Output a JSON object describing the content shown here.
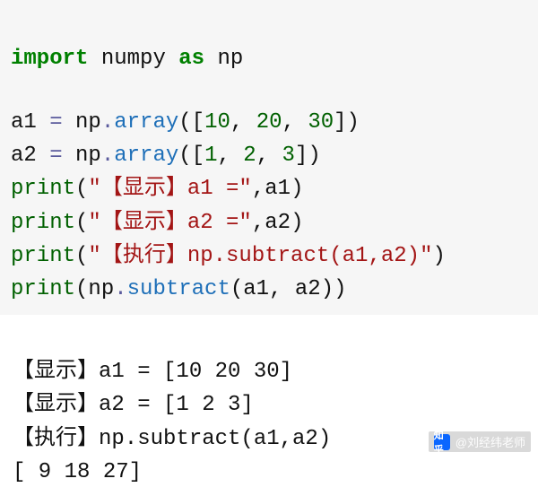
{
  "code": {
    "line1": {
      "import": "import",
      "numpy": "numpy",
      "as": "as",
      "np": "np"
    },
    "line3": {
      "a1": "a1",
      "eq": "=",
      "np": "np",
      "dot": ".",
      "array": "array",
      "lp": "(",
      "lb": "[",
      "v1": "10",
      "c": ",",
      "sp": " ",
      "v2": "20",
      "v3": "30",
      "rb": "]",
      "rp": ")"
    },
    "line4": {
      "a2": "a2",
      "eq": "=",
      "np": "np",
      "dot": ".",
      "array": "array",
      "lp": "(",
      "lb": "[",
      "v1": "1",
      "c": ",",
      "sp": " ",
      "v2": "2",
      "v3": "3",
      "rb": "]",
      "rp": ")"
    },
    "line5": {
      "print": "print",
      "lp": "(",
      "str": "\"【显示】a1 =\"",
      "c": ",",
      "a1": "a1",
      "rp": ")"
    },
    "line6": {
      "print": "print",
      "lp": "(",
      "str": "\"【显示】a2 =\"",
      "c": ",",
      "a2": "a2",
      "rp": ")"
    },
    "line7": {
      "print": "print",
      "lp": "(",
      "str": "\"【执行】np.subtract(a1,a2)\"",
      "rp": ")"
    },
    "line8": {
      "print": "print",
      "lp": "(",
      "np": "np",
      "dot": ".",
      "subtract": "subtract",
      "lp2": "(",
      "a1": "a1",
      "c": ",",
      "sp": " ",
      "a2": "a2",
      "rp2": ")",
      "rp": ")"
    }
  },
  "output": {
    "l1": "【显示】a1 = [10 20 30]",
    "l2": "【显示】a2 = [1 2 3]",
    "l3": "【执行】np.subtract(a1,a2)",
    "l4": "[ 9 18 27]"
  },
  "watermark": {
    "site": "知乎",
    "author": "@刘经纬老师"
  }
}
